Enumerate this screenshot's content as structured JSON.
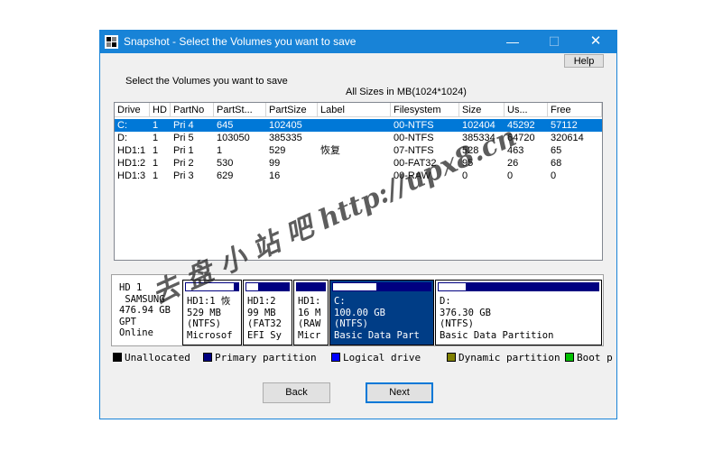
{
  "window": {
    "title": "Snapshot - Select the Volumes you want to save",
    "minimize_glyph": "—",
    "maximize_glyph": "☐",
    "close_glyph": "✕",
    "help_label": "Help"
  },
  "instruction": "Select the Volumes you want to save",
  "sizes_note": "All Sizes in MB(1024*1024)",
  "columns": [
    "Drive",
    "HD",
    "PartNo",
    "PartSt...",
    "PartSize",
    "Label",
    "Filesystem",
    "Size",
    "Us...",
    "Free"
  ],
  "rows": [
    {
      "drive": "C:",
      "hd": "1",
      "partno": "Pri  4",
      "partstart": "645",
      "partsize": "102405",
      "label": "",
      "filesystem": "00-NTFS",
      "size": "102404",
      "used": "45292",
      "free": "57112",
      "selected": true
    },
    {
      "drive": "D:",
      "hd": "1",
      "partno": "Pri  5",
      "partstart": "103050",
      "partsize": "385335",
      "label": "",
      "filesystem": "00-NTFS",
      "size": "385334",
      "used": "64720",
      "free": "320614",
      "selected": false
    },
    {
      "drive": "HD1:1",
      "hd": "1",
      "partno": "Pri  1",
      "partstart": "1",
      "partsize": "529",
      "label": "恢复",
      "filesystem": "07-NTFS",
      "size": "528",
      "used": "463",
      "free": "65",
      "selected": false
    },
    {
      "drive": "HD1:2",
      "hd": "1",
      "partno": "Pri  2",
      "partstart": "530",
      "partsize": "99",
      "label": "",
      "filesystem": "00-FAT32",
      "size": "95",
      "used": "26",
      "free": "68",
      "selected": false
    },
    {
      "drive": "HD1:3",
      "hd": "1",
      "partno": "Pri  3",
      "partstart": "629",
      "partsize": "16",
      "label": "",
      "filesystem": "00-RAW",
      "size": "0",
      "used": "0",
      "free": "0",
      "selected": false
    }
  ],
  "disk": {
    "info": "HD 1\n SAMSUNG \n476.94 GB\nGPT\nOnline"
  },
  "partitions": [
    {
      "text": "HD1:1 恢\n529 MB\n(NTFS)\nMicrosof",
      "used_fraction": 0.88,
      "selected": false
    },
    {
      "text": "HD1:2\n99 MB\n(FAT32\nEFI Sy",
      "used_fraction": 0.27,
      "selected": false
    },
    {
      "text": "HD1:\n16 M\n(RAW\nMicr",
      "used_fraction": 0.0,
      "selected": false
    },
    {
      "text": "C:\n100.00 GB\n(NTFS)\nBasic Data Part",
      "used_fraction": 0.44,
      "selected": true
    },
    {
      "text": "D:\n376.30 GB\n(NTFS)\nBasic Data Partition",
      "used_fraction": 0.17,
      "selected": false
    }
  ],
  "legend": [
    {
      "label": "Unallocated",
      "color": "#000000"
    },
    {
      "label": "Primary partition",
      "color": "#000080"
    },
    {
      "label": "Logical drive",
      "color": "#0000ff"
    },
    {
      "label": "Dynamic partition",
      "color": "#808000"
    },
    {
      "label": "Boot p",
      "color": "#00c000"
    }
  ],
  "buttons": {
    "back": "Back",
    "next": "Next"
  },
  "watermark": {
    "text": "去 盘 小 站 吧  http://upx8.cn"
  },
  "colors": {
    "titlebar": "#1883d7",
    "selection": "#0078d7",
    "partition_selected": "#003d86"
  }
}
